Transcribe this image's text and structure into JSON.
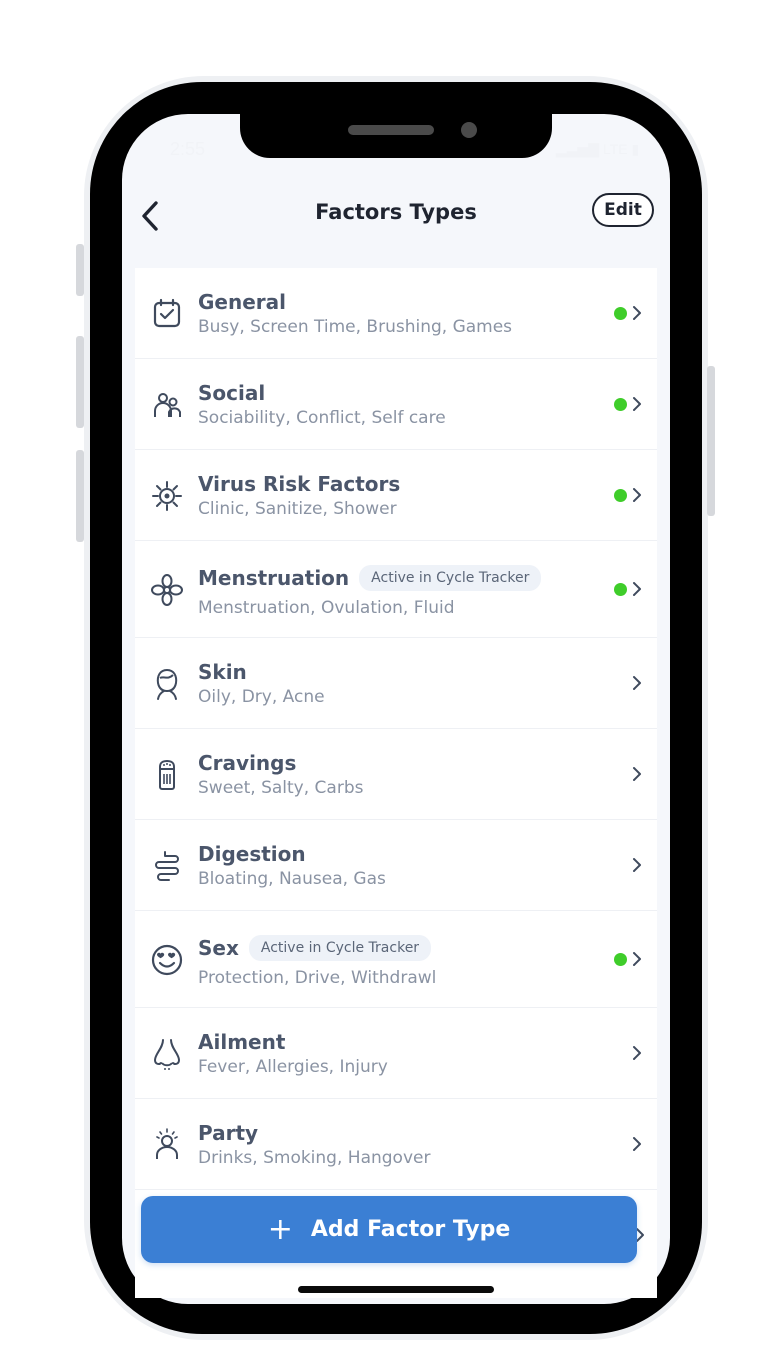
{
  "status_bar": {
    "time": "2:55",
    "network": "LTE"
  },
  "header": {
    "title": "Factors Types",
    "edit_label": "Edit"
  },
  "colors": {
    "accent": "#3b7fd4",
    "active_dot": "#3fcd2a",
    "title_text": "#4b566b",
    "subtitle_text": "#8a93a3"
  },
  "factors": [
    {
      "title": "General",
      "subtitle": "Busy, Screen Time, Brushing, Games",
      "icon": "calendar-check-icon",
      "active": true,
      "badge": ""
    },
    {
      "title": "Social",
      "subtitle": "Sociability, Conflict, Self care",
      "icon": "people-icon",
      "active": true,
      "badge": ""
    },
    {
      "title": "Virus Risk Factors",
      "subtitle": "Clinic, Sanitize, Shower",
      "icon": "virus-icon",
      "active": true,
      "badge": ""
    },
    {
      "title": "Menstruation",
      "subtitle": "Menstruation, Ovulation, Fluid",
      "icon": "flower-icon",
      "active": true,
      "badge": "Active in Cycle Tracker"
    },
    {
      "title": "Skin",
      "subtitle": "Oily, Dry, Acne",
      "icon": "face-icon",
      "active": false,
      "badge": ""
    },
    {
      "title": "Cravings",
      "subtitle": "Sweet, Salty, Carbs",
      "icon": "salt-shaker-icon",
      "active": false,
      "badge": ""
    },
    {
      "title": "Digestion",
      "subtitle": "Bloating, Nausea, Gas",
      "icon": "intestine-icon",
      "active": false,
      "badge": ""
    },
    {
      "title": "Sex",
      "subtitle": "Protection, Drive, Withdrawl",
      "icon": "smiley-heart-eyes-icon",
      "active": true,
      "badge": "Active in Cycle Tracker"
    },
    {
      "title": "Ailment",
      "subtitle": "Fever, Allergies, Injury",
      "icon": "nose-icon",
      "active": false,
      "badge": ""
    },
    {
      "title": "Party",
      "subtitle": "Drinks, Smoking, Hangover",
      "icon": "party-person-icon",
      "active": false,
      "badge": ""
    }
  ],
  "add_button": {
    "label": "Add Factor Type",
    "icon": "plus-icon"
  }
}
